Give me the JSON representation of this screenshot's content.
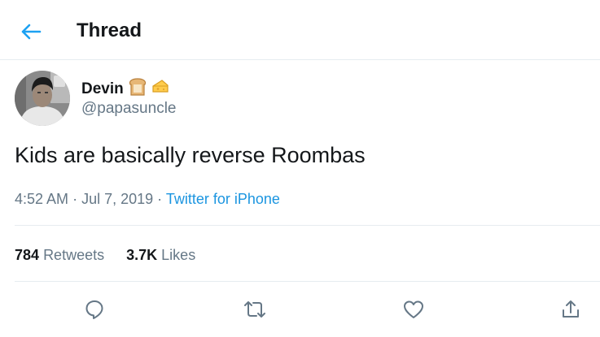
{
  "header": {
    "title": "Thread",
    "back_icon": "arrow-left-icon"
  },
  "colors": {
    "accent": "#1da1f2",
    "link": "#1b95e0",
    "text": "#14171a",
    "secondary": "#657786",
    "divider": "#e6ecf0"
  },
  "tweet": {
    "author": {
      "display_name": "Devin",
      "name_emojis": [
        "bread-emoji",
        "cheese-emoji"
      ],
      "handle": "@papasuncle"
    },
    "text": "Kids are basically reverse Roombas",
    "time": "4:52 AM",
    "date": "Jul 7, 2019",
    "separator": "·",
    "source": "Twitter for iPhone",
    "stats": {
      "retweets_count": "784",
      "retweets_label": "Retweets",
      "likes_count": "3.7K",
      "likes_label": "Likes"
    },
    "actions": [
      "reply-icon",
      "retweet-icon",
      "like-icon",
      "share-icon"
    ]
  }
}
